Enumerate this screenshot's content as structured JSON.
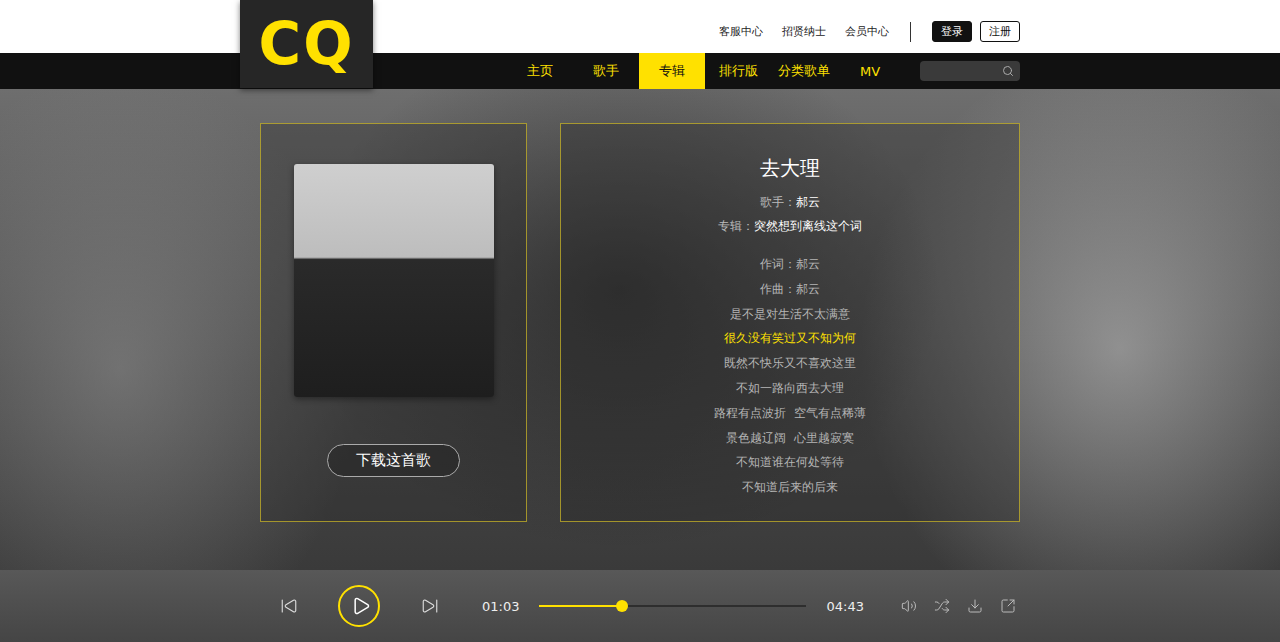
{
  "logo": "CQ",
  "top_links": [
    "客服中心",
    "招贤纳士",
    "会员中心"
  ],
  "auth_buttons": [
    {
      "label": "登录",
      "kind": "filled"
    },
    {
      "label": "注册",
      "kind": "outline"
    }
  ],
  "nav": [
    {
      "label": "主页",
      "selected": false
    },
    {
      "label": "歌手",
      "selected": false
    },
    {
      "label": "专辑",
      "selected": true
    },
    {
      "label": "排行版",
      "selected": false
    },
    {
      "label": "分类歌单",
      "selected": false
    },
    {
      "label": "MV",
      "selected": false
    }
  ],
  "song": {
    "title": "去大理",
    "meta": [
      {
        "label": "歌手：",
        "value": "郝云"
      },
      {
        "label": "专辑：",
        "value": "突然想到离线这个词"
      }
    ],
    "credits": [
      "作词：郝云",
      "作曲：郝云"
    ],
    "lyrics": [
      {
        "text": "是不是对生活不太满意",
        "selected": false
      },
      {
        "text": "很久没有笑过又不知为何",
        "selected": true
      },
      {
        "text": "既然不快乐又不喜欢这里",
        "selected": false
      },
      {
        "text": "不如一路向西去大理",
        "selected": false
      },
      {
        "text": "路程有点波折  空气有点稀薄",
        "selected": false
      },
      {
        "text": "景色越辽阔  心里越寂寞",
        "selected": false
      },
      {
        "text": "不知道谁在何处等待",
        "selected": false
      },
      {
        "text": "不知道后来的后来",
        "selected": false
      }
    ]
  },
  "download_button": "下载这首歌",
  "player": {
    "playing": false,
    "elapsed": "01:03",
    "duration": "04:43",
    "level": 0.31
  }
}
